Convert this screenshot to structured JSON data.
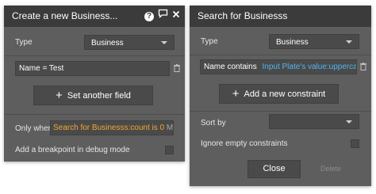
{
  "left_panel": {
    "title": "Create a new Business...",
    "help_glyph": "?",
    "type_label": "Type",
    "type_value": "Business",
    "field_row": "Name = Test",
    "set_field_button": "Set another field",
    "only_when_label": "Only when",
    "only_when_expr": "Search for Businesss:count is 0",
    "only_when_more": "More...",
    "breakpoint_label": "Add a breakpoint in debug mode"
  },
  "right_panel": {
    "title": "Search for Businesss",
    "type_label": "Type",
    "type_value": "Business",
    "constraint_key": "Name contains",
    "constraint_value": "Input Plate's value:uppercase",
    "add_constraint_button": "Add a new constraint",
    "sort_by_label": "Sort by",
    "ignore_empty_label": "Ignore empty constraints",
    "close_button": "Close",
    "delete_button": "Delete"
  },
  "icons": [
    "help-icon",
    "comment-icon",
    "close-icon",
    "trash-icon",
    "plus-icon",
    "chevron-down-icon"
  ]
}
